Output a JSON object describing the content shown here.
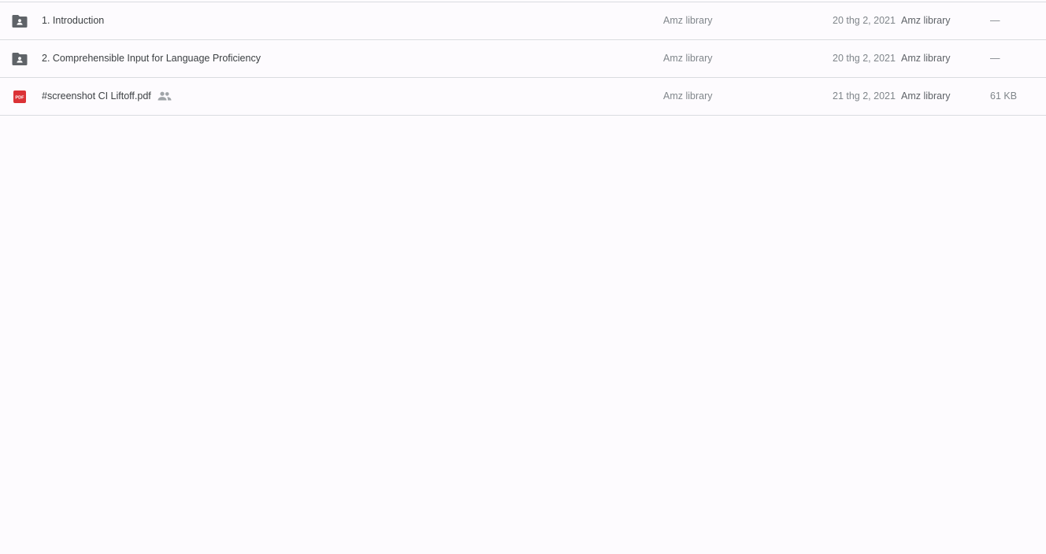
{
  "colors": {
    "background": "#fdfbfe",
    "folder_icon": "#5f6368",
    "pdf_icon": "#db3236",
    "divider": "#dadce0"
  },
  "files": [
    {
      "icon": "shared-folder-icon",
      "name": "1. Introduction",
      "owner": "Amz library",
      "modified": "20 thg 2, 2021",
      "modified_by": "Amz library",
      "size": "—",
      "shared": false
    },
    {
      "icon": "shared-folder-icon",
      "name": "2. Comprehensible Input for Language Proficiency",
      "owner": "Amz library",
      "modified": "20 thg 2, 2021",
      "modified_by": "Amz library",
      "size": "—",
      "shared": false
    },
    {
      "icon": "pdf-icon",
      "pdf_label": "PDF",
      "name": "#screenshot CI Liftoff.pdf",
      "owner": "Amz library",
      "modified": "21 thg 2, 2021",
      "modified_by": "Amz library",
      "size": "61 KB",
      "shared": true,
      "shared_icon": "people-icon"
    }
  ]
}
